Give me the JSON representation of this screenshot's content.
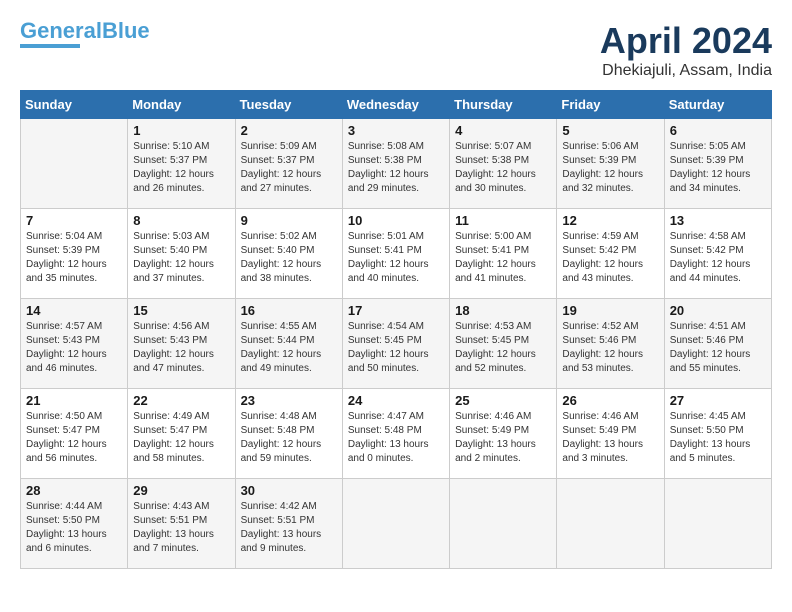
{
  "header": {
    "logo_line1": "General",
    "logo_line2": "Blue",
    "month": "April 2024",
    "location": "Dhekiajuli, Assam, India"
  },
  "weekdays": [
    "Sunday",
    "Monday",
    "Tuesday",
    "Wednesday",
    "Thursday",
    "Friday",
    "Saturday"
  ],
  "weeks": [
    [
      {
        "day": "",
        "info": ""
      },
      {
        "day": "1",
        "info": "Sunrise: 5:10 AM\nSunset: 5:37 PM\nDaylight: 12 hours\nand 26 minutes."
      },
      {
        "day": "2",
        "info": "Sunrise: 5:09 AM\nSunset: 5:37 PM\nDaylight: 12 hours\nand 27 minutes."
      },
      {
        "day": "3",
        "info": "Sunrise: 5:08 AM\nSunset: 5:38 PM\nDaylight: 12 hours\nand 29 minutes."
      },
      {
        "day": "4",
        "info": "Sunrise: 5:07 AM\nSunset: 5:38 PM\nDaylight: 12 hours\nand 30 minutes."
      },
      {
        "day": "5",
        "info": "Sunrise: 5:06 AM\nSunset: 5:39 PM\nDaylight: 12 hours\nand 32 minutes."
      },
      {
        "day": "6",
        "info": "Sunrise: 5:05 AM\nSunset: 5:39 PM\nDaylight: 12 hours\nand 34 minutes."
      }
    ],
    [
      {
        "day": "7",
        "info": "Sunrise: 5:04 AM\nSunset: 5:39 PM\nDaylight: 12 hours\nand 35 minutes."
      },
      {
        "day": "8",
        "info": "Sunrise: 5:03 AM\nSunset: 5:40 PM\nDaylight: 12 hours\nand 37 minutes."
      },
      {
        "day": "9",
        "info": "Sunrise: 5:02 AM\nSunset: 5:40 PM\nDaylight: 12 hours\nand 38 minutes."
      },
      {
        "day": "10",
        "info": "Sunrise: 5:01 AM\nSunset: 5:41 PM\nDaylight: 12 hours\nand 40 minutes."
      },
      {
        "day": "11",
        "info": "Sunrise: 5:00 AM\nSunset: 5:41 PM\nDaylight: 12 hours\nand 41 minutes."
      },
      {
        "day": "12",
        "info": "Sunrise: 4:59 AM\nSunset: 5:42 PM\nDaylight: 12 hours\nand 43 minutes."
      },
      {
        "day": "13",
        "info": "Sunrise: 4:58 AM\nSunset: 5:42 PM\nDaylight: 12 hours\nand 44 minutes."
      }
    ],
    [
      {
        "day": "14",
        "info": "Sunrise: 4:57 AM\nSunset: 5:43 PM\nDaylight: 12 hours\nand 46 minutes."
      },
      {
        "day": "15",
        "info": "Sunrise: 4:56 AM\nSunset: 5:43 PM\nDaylight: 12 hours\nand 47 minutes."
      },
      {
        "day": "16",
        "info": "Sunrise: 4:55 AM\nSunset: 5:44 PM\nDaylight: 12 hours\nand 49 minutes."
      },
      {
        "day": "17",
        "info": "Sunrise: 4:54 AM\nSunset: 5:45 PM\nDaylight: 12 hours\nand 50 minutes."
      },
      {
        "day": "18",
        "info": "Sunrise: 4:53 AM\nSunset: 5:45 PM\nDaylight: 12 hours\nand 52 minutes."
      },
      {
        "day": "19",
        "info": "Sunrise: 4:52 AM\nSunset: 5:46 PM\nDaylight: 12 hours\nand 53 minutes."
      },
      {
        "day": "20",
        "info": "Sunrise: 4:51 AM\nSunset: 5:46 PM\nDaylight: 12 hours\nand 55 minutes."
      }
    ],
    [
      {
        "day": "21",
        "info": "Sunrise: 4:50 AM\nSunset: 5:47 PM\nDaylight: 12 hours\nand 56 minutes."
      },
      {
        "day": "22",
        "info": "Sunrise: 4:49 AM\nSunset: 5:47 PM\nDaylight: 12 hours\nand 58 minutes."
      },
      {
        "day": "23",
        "info": "Sunrise: 4:48 AM\nSunset: 5:48 PM\nDaylight: 12 hours\nand 59 minutes."
      },
      {
        "day": "24",
        "info": "Sunrise: 4:47 AM\nSunset: 5:48 PM\nDaylight: 13 hours\nand 0 minutes."
      },
      {
        "day": "25",
        "info": "Sunrise: 4:46 AM\nSunset: 5:49 PM\nDaylight: 13 hours\nand 2 minutes."
      },
      {
        "day": "26",
        "info": "Sunrise: 4:46 AM\nSunset: 5:49 PM\nDaylight: 13 hours\nand 3 minutes."
      },
      {
        "day": "27",
        "info": "Sunrise: 4:45 AM\nSunset: 5:50 PM\nDaylight: 13 hours\nand 5 minutes."
      }
    ],
    [
      {
        "day": "28",
        "info": "Sunrise: 4:44 AM\nSunset: 5:50 PM\nDaylight: 13 hours\nand 6 minutes."
      },
      {
        "day": "29",
        "info": "Sunrise: 4:43 AM\nSunset: 5:51 PM\nDaylight: 13 hours\nand 7 minutes."
      },
      {
        "day": "30",
        "info": "Sunrise: 4:42 AM\nSunset: 5:51 PM\nDaylight: 13 hours\nand 9 minutes."
      },
      {
        "day": "",
        "info": ""
      },
      {
        "day": "",
        "info": ""
      },
      {
        "day": "",
        "info": ""
      },
      {
        "day": "",
        "info": ""
      }
    ]
  ]
}
